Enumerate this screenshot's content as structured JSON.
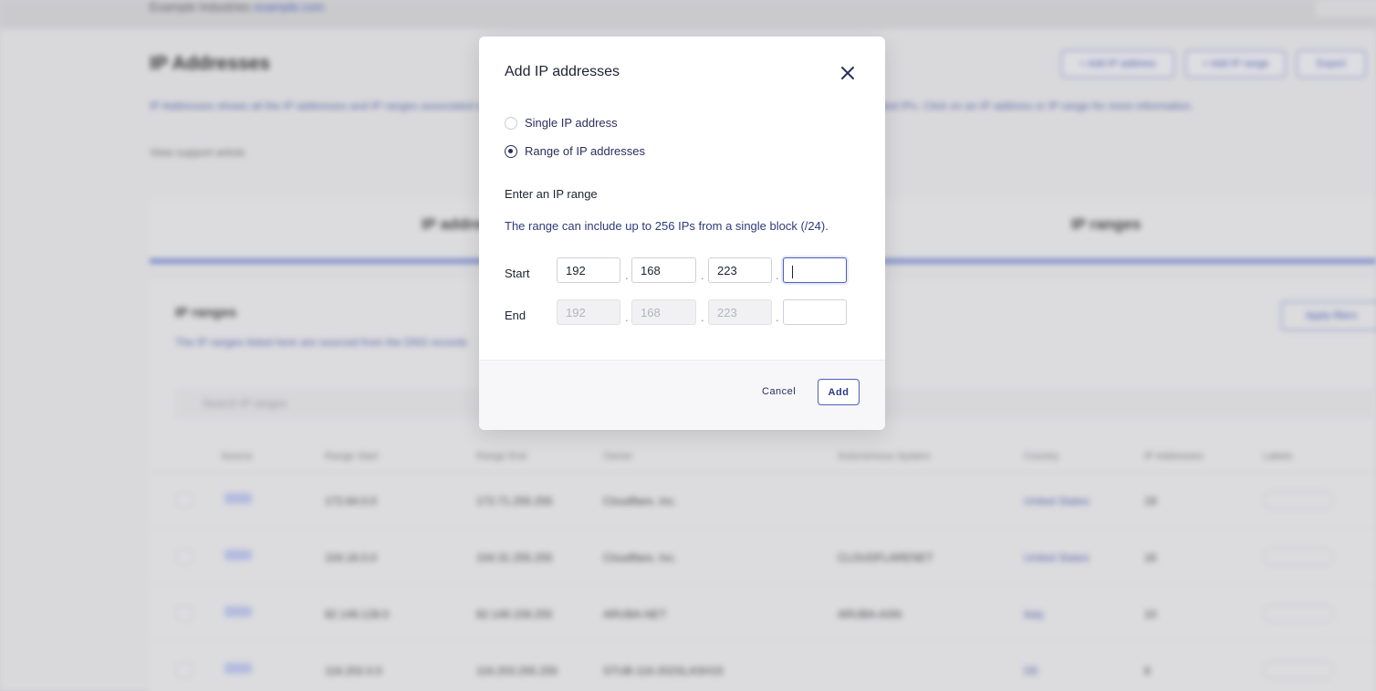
{
  "background": {
    "org_name": "Example Industries",
    "org_link": "example.com",
    "page_title": "IP Addresses",
    "actions": [
      "+ Add IP address",
      "+ Add IP range",
      "Export"
    ],
    "description": "IP Addresses shows all the IP addresses and IP ranges associated with your company's domains, IP ranges owned by your company, and manually added IPs. Click on an IP address or IP range for more information.",
    "support_link": "View support article",
    "tab_ip_addresses": "IP addresses",
    "tab_ip_ranges": "IP ranges",
    "panel_title": "IP ranges",
    "panel_subtitle": "The IP ranges listed here are sourced from the DNS records",
    "apply_filters": "Apply filters",
    "search_placeholder": "Search IP ranges",
    "columns": [
      "Source",
      "Range Start",
      "Range End",
      "Owner",
      "Autonomous System",
      "Country",
      "IP Addresses",
      "Labels"
    ],
    "rows": [
      {
        "start": "172.64.0.0",
        "end": "172.71.255.255",
        "owner": "Cloudflare, Inc.",
        "as": "",
        "country": "United States",
        "count": "19"
      },
      {
        "start": "104.16.0.0",
        "end": "104.31.255.255",
        "owner": "Cloudflare, Inc.",
        "as": "CLOUDFLARENET",
        "country": "United States",
        "count": "16"
      },
      {
        "start": "82.149.128.0",
        "end": "82.149.159.255",
        "owner": "ARUBA-NET",
        "as": "ARUBA-ASN",
        "country": "Italy",
        "count": "10"
      },
      {
        "start": "116.202.0.0",
        "end": "116.203.255.255",
        "owner": "STUB-116-202SLASH15",
        "as": "",
        "country": "DE",
        "count": "8"
      }
    ]
  },
  "modal": {
    "title": "Add IP addresses",
    "options": [
      {
        "label": "Single IP address",
        "selected": false
      },
      {
        "label": "Range of IP addresses",
        "selected": true
      }
    ],
    "section_label": "Enter an IP range",
    "helper_text": "The range can include up to 256 IPs from a single block (/24).",
    "start_label": "Start",
    "end_label": "End",
    "start_octets": [
      "192",
      "168",
      "223",
      ""
    ],
    "end_octets": [
      "192",
      "168",
      "223",
      ""
    ],
    "separator": ".",
    "cancel_label": "Cancel",
    "add_label": "Add"
  },
  "colors": {
    "accent": "#4c5fb8",
    "text_primary": "#1f2233",
    "text_link": "#2f3a7a",
    "disabled_bg": "#f1f1f3"
  }
}
